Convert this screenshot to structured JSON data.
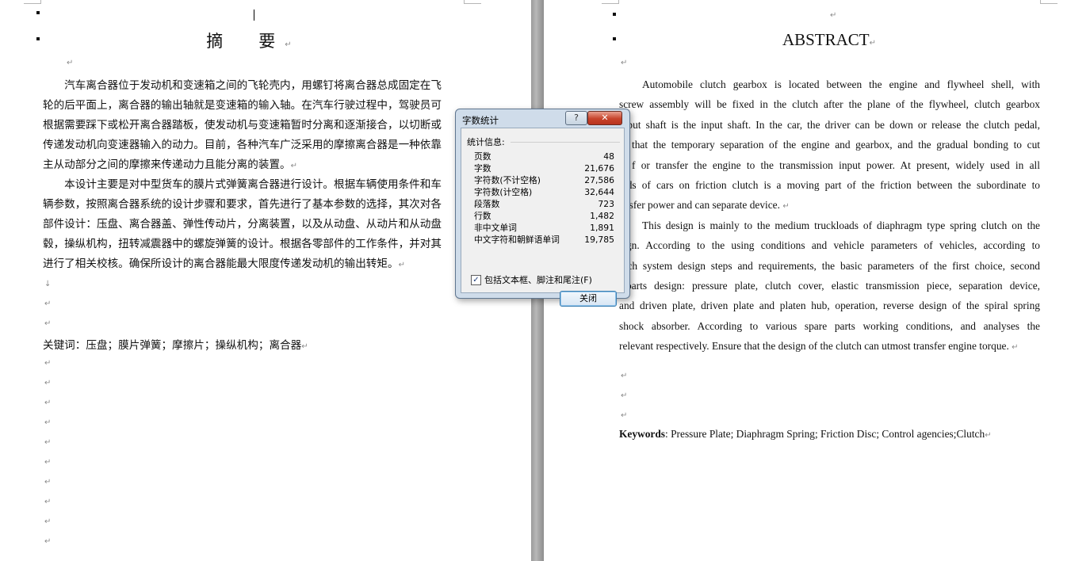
{
  "left_page": {
    "title": "摘　要",
    "body_lines": [
      "　　汽车离合器位于发动机和变速箱之间的飞轮壳内，用螺钉将离合器总成固定在飞",
      "轮的后平面上，离合器的输出轴就是变速箱的输入轴。在汽车行驶过程中，驾驶员可",
      "根据需要踩下或松开离合器踏板，使发动机与变速箱暂时分离和逐渐接合，以切断或",
      "传递发动机向变速器输入的动力。目前，各种汽车广泛采用的摩擦离合器是一种依靠",
      "主从动部分之间的摩擦来传递动力且能分离的装置。",
      "　　本设计主要是对中型货车的膜片式弹簧离合器进行设计。根据车辆使用条件和车",
      "辆参数，按照离合器系统的设计步骤和要求，首先进行了基本参数的选择，其次对各",
      "部件设计：压盘、离合器盖、弹性传动片，分离装置，以及从动盘、从动片和从动盘",
      "毂，操纵机构，扭转减震器中的螺旋弹簧的设计。根据各零部件的工作条件，并对其",
      "进行了相关校核。确保所设计的离合器能最大限度传递发动机的输出转矩。"
    ],
    "keywords": "关键词：压盘；膜片弹簧；摩擦片；操纵机构；离合器"
  },
  "right_page": {
    "title": "ABSTRACT",
    "body_lines": [
      "Automobile clutch gearbox is located between the engine and flywheel shell, with",
      "screw assembly will be fixed in the clutch after the plane of the flywheel, clutch gearbox",
      "utput shaft is the input shaft. In the car, the driver can be down or release the clutch pedal,",
      "that the temporary separation of the engine and gearbox, and the gradual bonding to cut",
      "f or transfer the engine to the transmission input power. At present, widely used in all",
      "nds of cars on friction clutch is a moving part of the friction between the subordinate to",
      "ansfer power and can separate device.",
      "This design is mainly to the medium truckloads of diaphragm type spring clutch on the",
      "sign. According to the using conditions and vehicle parameters of vehicles, according to",
      "utch system design steps and requirements, the basic parameters of the first choice, second",
      "parts design: pressure plate, clutch cover, elastic transmission piece, separation device,",
      "and driven plate, driven plate and platen hub, operation, reverse design of the spiral spring",
      "shock absorber. According to various spare parts working conditions, and analyses the",
      "relevant respectively. Ensure that the design of the clutch can utmost transfer engine torque."
    ],
    "keywords_label": "Keywords",
    "keywords": ": Pressure Plate; Diaphragm Spring; Friction Disc; Control agencies;Clutch"
  },
  "marks": {
    "paragraph": "↵",
    "line_break": "↓"
  },
  "dialog": {
    "title": "字数统计",
    "help_label": "?",
    "close_x": "✕",
    "group_label": "统计信息:",
    "stats": [
      {
        "label": "页数",
        "value": "48"
      },
      {
        "label": "字数",
        "value": "21,676"
      },
      {
        "label": "字符数(不计空格)",
        "value": "27,586"
      },
      {
        "label": "字符数(计空格)",
        "value": "32,644"
      },
      {
        "label": "段落数",
        "value": "723"
      },
      {
        "label": "行数",
        "value": "1,482"
      },
      {
        "label": "非中文单词",
        "value": "1,891"
      },
      {
        "label": "中文字符和朝鲜语单词",
        "value": "19,785"
      }
    ],
    "checkbox_label": "包括文本框、脚注和尾注(F)",
    "checkbox_mark": "✓",
    "ok_label": "关闭"
  }
}
